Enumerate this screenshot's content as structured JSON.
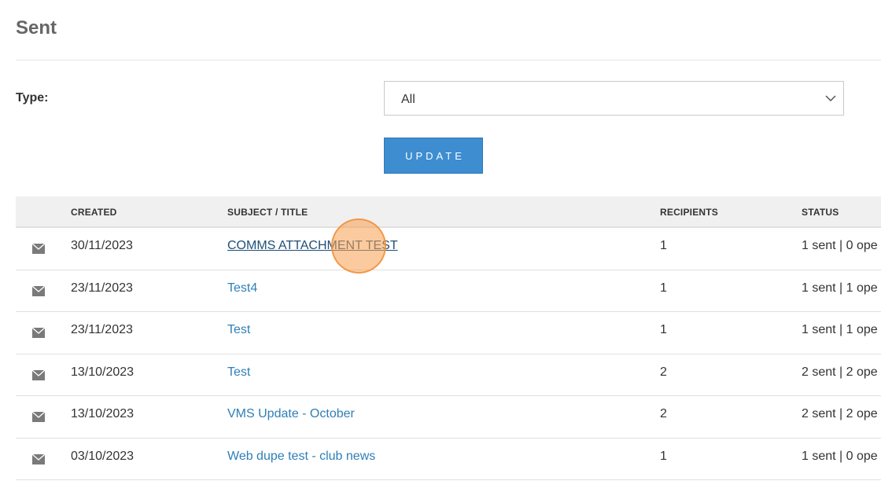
{
  "page": {
    "title": "Sent"
  },
  "filter": {
    "type_label": "Type:",
    "type_value": "All",
    "update_label": "UPDATE"
  },
  "table": {
    "columns": [
      "",
      "CREATED",
      "SUBJECT / TITLE",
      "RECIPIENTS",
      "STATUS"
    ],
    "rows": [
      {
        "icon": "envelope-icon",
        "created": "30/11/2023",
        "subject": "COMMS ATTACHMENT TEST",
        "recipients": "1",
        "status": "1 sent | 0 ope"
      },
      {
        "icon": "envelope-icon",
        "created": "23/11/2023",
        "subject": "Test4",
        "recipients": "1",
        "status": "1 sent | 1 ope"
      },
      {
        "icon": "envelope-icon",
        "created": "23/11/2023",
        "subject": "Test",
        "recipients": "1",
        "status": "1 sent | 1 ope"
      },
      {
        "icon": "envelope-icon",
        "created": "13/10/2023",
        "subject": "Test",
        "recipients": "2",
        "status": "2 sent | 2 ope"
      },
      {
        "icon": "envelope-icon",
        "created": "13/10/2023",
        "subject": "VMS Update - October",
        "recipients": "2",
        "status": "2 sent | 2 ope"
      },
      {
        "icon": "envelope-icon",
        "created": "03/10/2023",
        "subject": "Web dupe test - club news",
        "recipients": "1",
        "status": "1 sent | 0 ope"
      }
    ]
  },
  "colors": {
    "link": "#2f7fb8",
    "button": "#3d8dd0",
    "header_bg": "#f0f0f0",
    "cursor_highlight": "#f7a050"
  }
}
